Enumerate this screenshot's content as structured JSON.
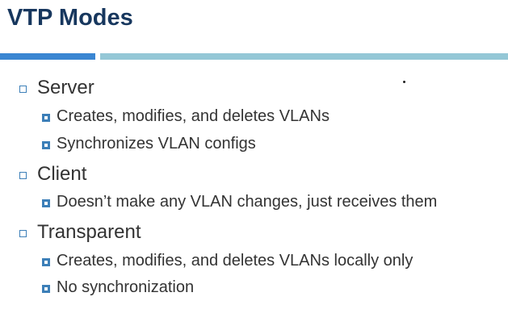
{
  "title": "VTP Modes",
  "items": [
    {
      "level": 1,
      "text": "Server"
    },
    {
      "level": 2,
      "text": "Creates, modifies, and deletes VLANs"
    },
    {
      "level": 2,
      "text": "Synchronizes VLAN configs"
    },
    {
      "level": 1,
      "text": "Client"
    },
    {
      "level": 2,
      "text": "Doesn’t make any VLAN changes, just receives them"
    },
    {
      "level": 1,
      "text": "Transparent"
    },
    {
      "level": 2,
      "text": "Creates, modifies, and deletes VLANs locally only"
    },
    {
      "level": 2,
      "text": "No synchronization"
    }
  ],
  "colors": {
    "title": "#17375e",
    "bar_primary": "#3a86d2",
    "bar_secondary": "#94c7d6",
    "bullet": "#3c7fb8"
  }
}
